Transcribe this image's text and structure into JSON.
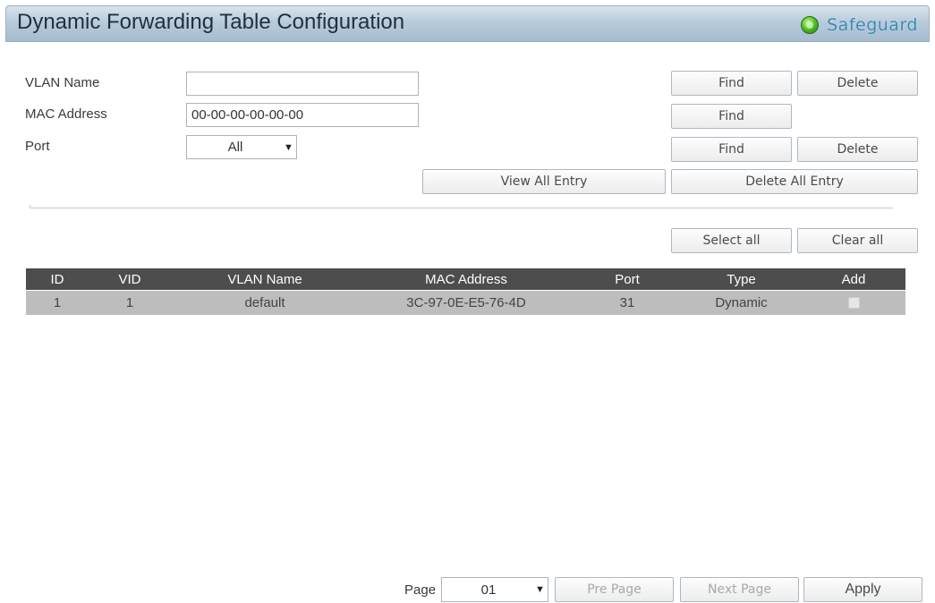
{
  "header": {
    "title": "Dynamic Forwarding Table Configuration",
    "safeguard_label": "Safeguard",
    "safeguard_icon": "status-led-icon",
    "safeguard_color": "#4caf27"
  },
  "form": {
    "vlan_name_label": "VLAN Name",
    "vlan_name_value": "",
    "mac_address_label": "MAC Address",
    "mac_address_value": "00-00-00-00-00-00",
    "port_label": "Port",
    "port_value": "All"
  },
  "buttons": {
    "find": "Find",
    "delete": "Delete",
    "view_all_entry": "View All Entry",
    "delete_all_entry": "Delete All Entry",
    "select_all": "Select all",
    "clear_all": "Clear all",
    "pre_page": "Pre Page",
    "next_page": "Next Page",
    "apply": "Apply"
  },
  "table": {
    "columns": [
      "ID",
      "VID",
      "VLAN Name",
      "MAC Address",
      "Port",
      "Type",
      "Add"
    ],
    "rows": [
      {
        "id": "1",
        "vid": "1",
        "vlan_name": "default",
        "mac_address": "3C-97-0E-E5-76-4D",
        "port": "31",
        "type": "Dynamic",
        "add": false
      }
    ]
  },
  "pagination": {
    "page_label": "Page",
    "page_value": "01"
  }
}
